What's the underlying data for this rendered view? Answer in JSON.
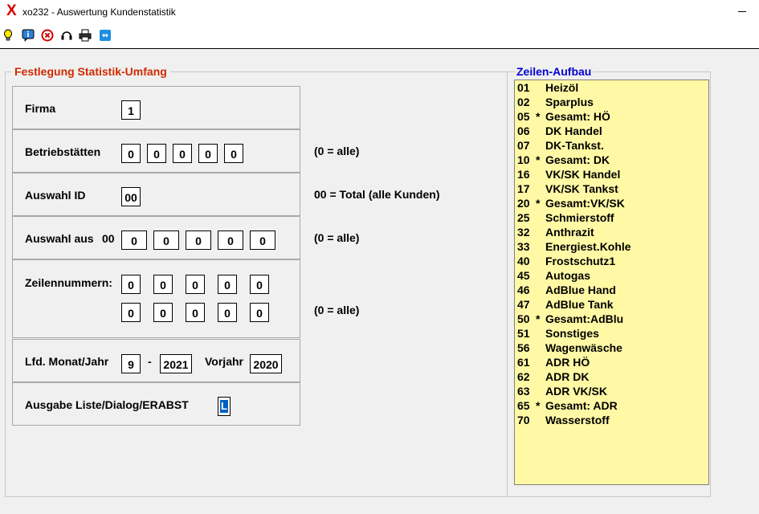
{
  "window": {
    "title": "xo232 - Auswertung Kundenstatistik",
    "app_icon": "X"
  },
  "toolbar": {
    "icons": [
      "lightbulb-icon",
      "info-icon",
      "close-circle-icon",
      "headset-icon",
      "printer-icon",
      "remote-icon"
    ]
  },
  "left": {
    "group_title": "Festlegung Statistik-Umfang",
    "firma": {
      "label": "Firma",
      "value": "1"
    },
    "betriebsstaetten": {
      "label": "Betriebstätten",
      "values": [
        "0",
        "0",
        "0",
        "0",
        "0"
      ],
      "hint": "(0 = alle)"
    },
    "auswahl_id": {
      "label": "Auswahl ID",
      "value": "00",
      "hint": "00 = Total (alle Kunden)"
    },
    "auswahl_aus": {
      "label": "Auswahl aus",
      "prefix": "00",
      "values": [
        "0",
        "0",
        "0",
        "0",
        "0"
      ],
      "hint": "(0 = alle)"
    },
    "zeilennummern": {
      "label": "Zeilennummern:",
      "row1": [
        "0",
        "0",
        "0",
        "0",
        "0"
      ],
      "row2": [
        "0",
        "0",
        "0",
        "0",
        "0"
      ],
      "hint": "(0 = alle)"
    },
    "lfd": {
      "label": "Lfd. Monat/Jahr",
      "month": "9",
      "dash": "-",
      "year": "2021",
      "vorjahr_label": "Vorjahr",
      "vorjahr": "2020"
    },
    "ausgabe": {
      "label": "Ausgabe Liste/Dialog/ERABST",
      "value": "L"
    }
  },
  "right": {
    "title": "Zeilen-Aufbau",
    "rows": [
      {
        "code": "01",
        "star": "",
        "name": "Heizöl"
      },
      {
        "code": "02",
        "star": "",
        "name": "Sparplus"
      },
      {
        "code": "05",
        "star": "*",
        "name": "Gesamt: HÖ"
      },
      {
        "code": "06",
        "star": "",
        "name": "DK Handel"
      },
      {
        "code": "07",
        "star": "",
        "name": "DK-Tankst."
      },
      {
        "code": "10",
        "star": "*",
        "name": "Gesamt: DK"
      },
      {
        "code": "16",
        "star": "",
        "name": "VK/SK Handel"
      },
      {
        "code": "17",
        "star": "",
        "name": "VK/SK Tankst"
      },
      {
        "code": "20",
        "star": "*",
        "name": "Gesamt:VK/SK"
      },
      {
        "code": "25",
        "star": "",
        "name": "Schmierstoff"
      },
      {
        "code": "32",
        "star": "",
        "name": "Anthrazit"
      },
      {
        "code": "33",
        "star": "",
        "name": "Energiest.Kohle"
      },
      {
        "code": "40",
        "star": "",
        "name": "Frostschutz1"
      },
      {
        "code": "45",
        "star": "",
        "name": "Autogas"
      },
      {
        "code": "46",
        "star": "",
        "name": "AdBlue Hand"
      },
      {
        "code": "47",
        "star": "",
        "name": "AdBlue Tank"
      },
      {
        "code": "50",
        "star": "*",
        "name": "Gesamt:AdBlu"
      },
      {
        "code": "51",
        "star": "",
        "name": "Sonstiges"
      },
      {
        "code": "56",
        "star": "",
        "name": "Wagenwäsche"
      },
      {
        "code": "61",
        "star": "",
        "name": "ADR HÖ"
      },
      {
        "code": "62",
        "star": "",
        "name": "ADR DK"
      },
      {
        "code": "63",
        "star": "",
        "name": "ADR VK/SK"
      },
      {
        "code": "65",
        "star": "*",
        "name": "Gesamt: ADR"
      },
      {
        "code": "70",
        "star": "",
        "name": "Wasserstoff"
      }
    ]
  },
  "colors": {
    "group_title": "#d02a00",
    "list_title": "#0000d0",
    "list_bg": "#fff9a5",
    "cursor": "#0060c0"
  }
}
